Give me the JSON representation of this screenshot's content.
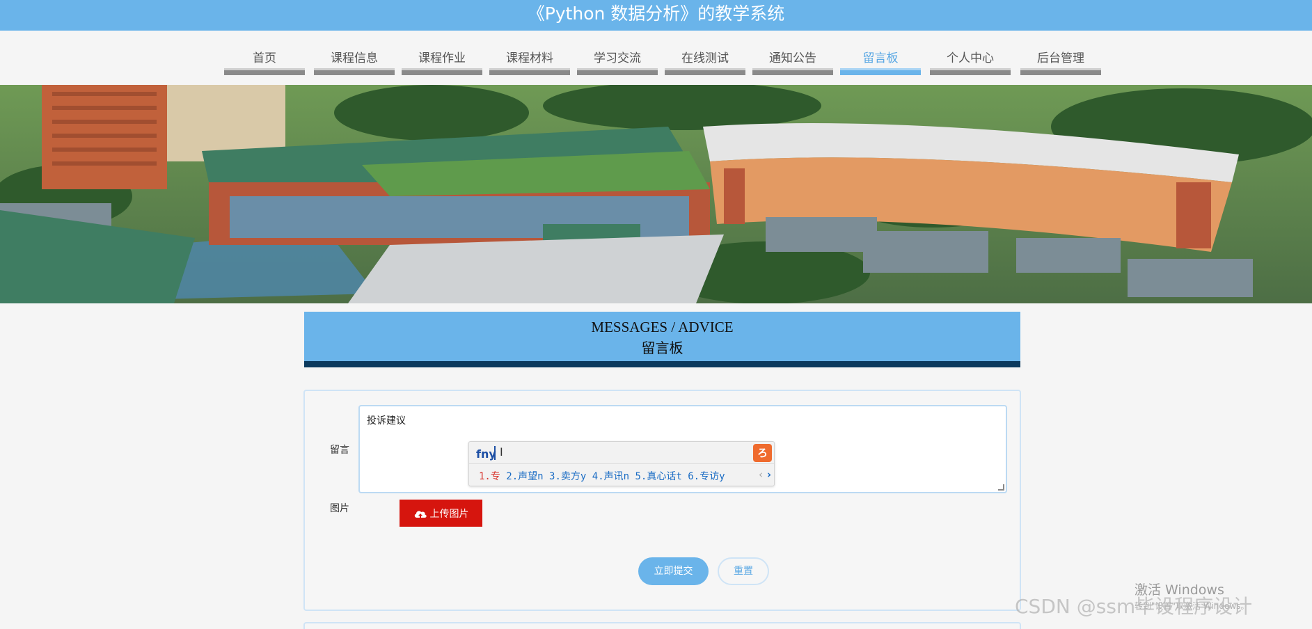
{
  "header": {
    "title": "《Python 数据分析》的教学系统"
  },
  "nav": {
    "items": [
      {
        "label": "首页"
      },
      {
        "label": "课程信息"
      },
      {
        "label": "课程作业"
      },
      {
        "label": "课程材料"
      },
      {
        "label": "学习交流"
      },
      {
        "label": "在线测试"
      },
      {
        "label": "通知公告"
      },
      {
        "label": "留言板"
      },
      {
        "label": "个人中心"
      },
      {
        "label": "后台管理"
      }
    ],
    "active": "留言板"
  },
  "section": {
    "title_en": "MESSAGES / ADVICE",
    "title_cn": "留言板"
  },
  "form": {
    "message_label": "留言",
    "message_value": "投诉建议",
    "image_label": "图片",
    "upload_label": "上传图片",
    "submit_label": "立即提交",
    "reset_label": "重置"
  },
  "ime": {
    "composition": "fny",
    "candidates": [
      "1.专",
      "2.声望n",
      "3.卖方y",
      "4.声讯n",
      "5.真心话t",
      "6.专访y"
    ]
  },
  "watermarks": {
    "windows_title": "激活 Windows",
    "windows_sub": "转到\"设置\"以激活 Windows。",
    "csdn": "CSDN @ssm毕设程序设计"
  },
  "colors": {
    "accent": "#6ab4ea",
    "header_bar": "#0c3a5e",
    "upload_button": "#d6150e"
  }
}
